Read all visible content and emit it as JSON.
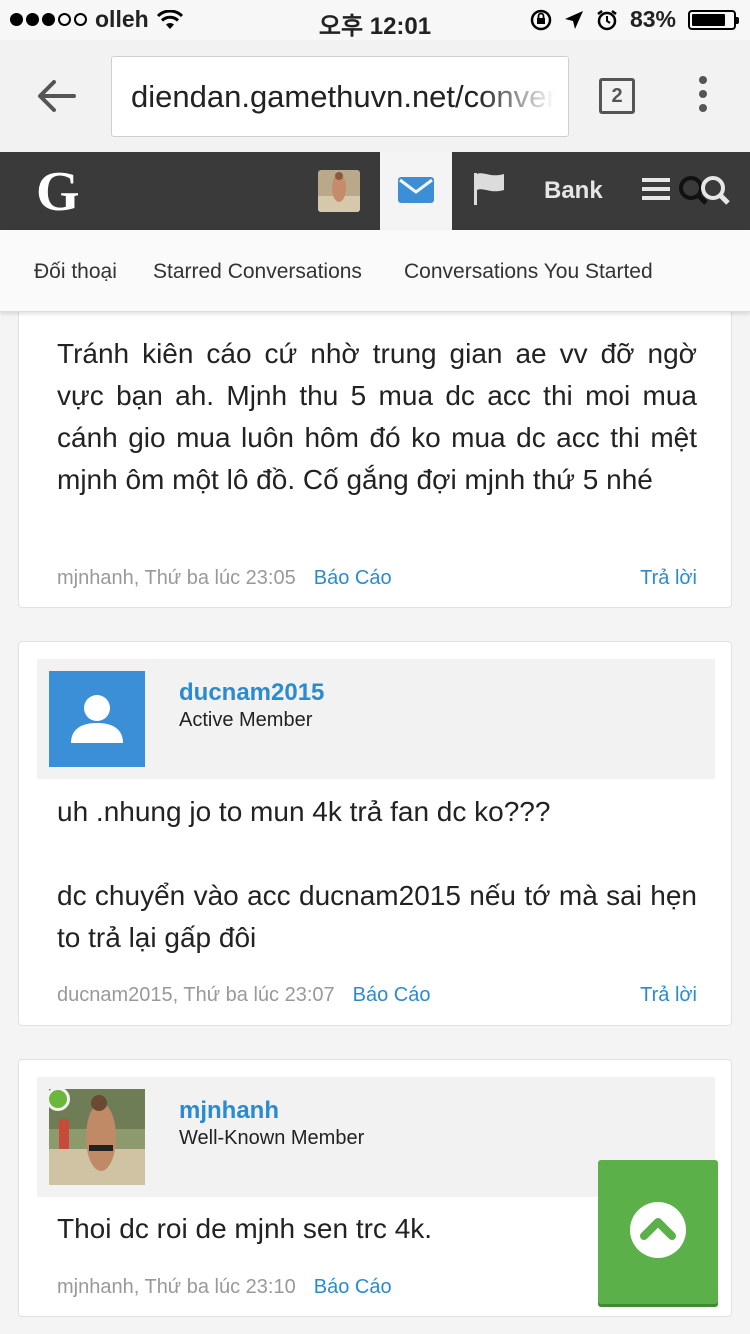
{
  "status_bar": {
    "carrier": "olleh",
    "time": "오후 12:01",
    "battery_text": "83%",
    "battery_level": 0.83,
    "signal_bars": 3,
    "signal_total": 5
  },
  "browser": {
    "url": "diendan.gamethuvn.net/conversations",
    "tab_count": "2"
  },
  "site_nav": {
    "logo": "G",
    "bank_label": "Bank",
    "active_color": "#3b8fd6"
  },
  "conversation_tabs": [
    {
      "label": "Đối thoại"
    },
    {
      "label": "Starred Conversations"
    },
    {
      "label": "Conversations You Started"
    }
  ],
  "messages": [
    {
      "body": "Tránh kiên cáo cứ nhờ trung gian ae vv đỡ ngờ vực bạn ah. Mjnh thu 5 mua dc acc thi moi mua cánh gio mua luôn hôm đó ko mua dc acc thi mệt mjnh ôm một lô đồ. Cố gắng đợi mjnh thứ 5 nhé",
      "meta": "mjnhanh, Thứ ba lúc 23:05",
      "report_label": "Báo Cáo",
      "reply_label": "Trả lời"
    },
    {
      "username": "ducnam2015",
      "user_title": "Active Member",
      "body_lines": [
        "uh .nhung jo to mun 4k trả fan dc ko???",
        "dc chuyển vào acc ducnam2015 nếu tớ mà sai hẹn to trả lại gấp đôi"
      ],
      "meta": "ducnam2015, Thứ ba lúc 23:07",
      "report_label": "Báo Cáo",
      "reply_label": "Trả lời"
    },
    {
      "username": "mjnhanh",
      "user_title": "Well-Known Member",
      "body": "Thoi dc roi de mjnh sen trc 4k.",
      "meta": "mjnhanh, Thứ ba lúc 23:10",
      "report_label": "Báo Cáo"
    }
  ],
  "colors": {
    "link_blue": "#2b8bd1",
    "nav_dark": "#3a3a3a",
    "scroll_top_green": "#5cb04a"
  }
}
